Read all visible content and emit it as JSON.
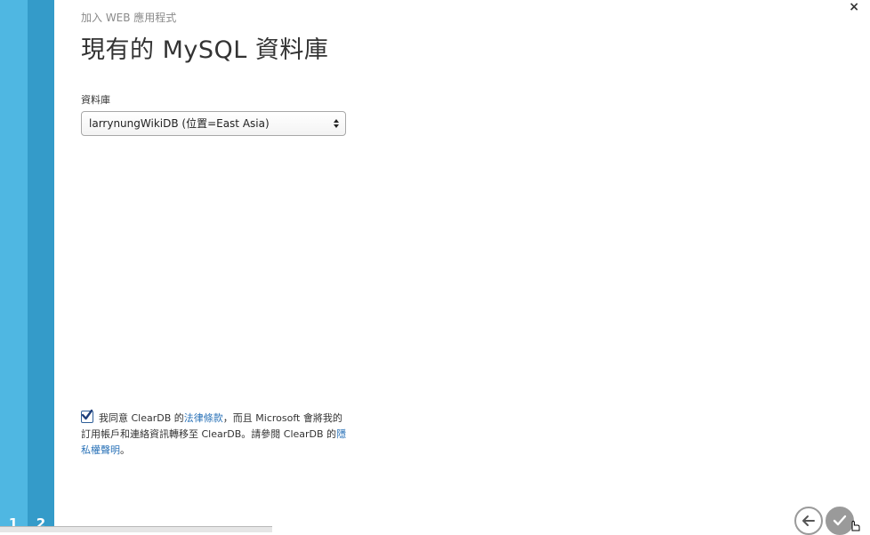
{
  "wizard": {
    "steps": [
      "1",
      "2"
    ],
    "subtitle": "加入 WEB 應用程式",
    "title": "現有的 MySQL 資料庫",
    "close_label": "×"
  },
  "form": {
    "database_label": "資料庫",
    "database_value": "larrynungWikiDB (位置=East Asia)"
  },
  "consent": {
    "checked": true,
    "text_1": "我同意 ClearDB 的",
    "link_terms": "法律條款",
    "text_2": "，而且 Microsoft 會將我的訂用帳戶和連絡資訊轉移至 ClearDB。請參閱 ClearDB 的",
    "link_privacy": "隱私權聲明",
    "text_3": "。"
  },
  "nav": {
    "back_icon": "arrow-left-icon",
    "done_icon": "checkmark-icon"
  },
  "colors": {
    "rail_step1": "#4fb7e2",
    "rail_step2": "#349bc9",
    "link": "#2b73b8"
  }
}
